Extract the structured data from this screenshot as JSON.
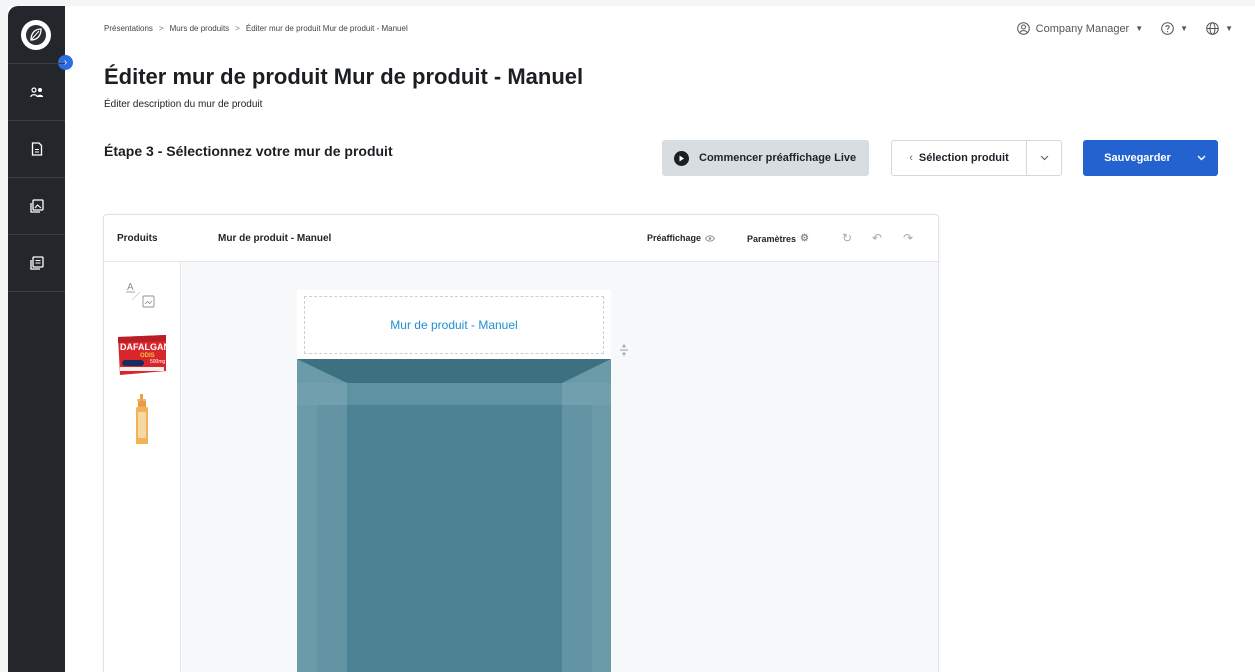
{
  "breadcrumb": {
    "items": [
      "Présentations",
      "Murs de produits",
      "Éditer mur de produit Mur de produit - Manuel"
    ],
    "separator": ">"
  },
  "topbar": {
    "user_label": "Company Manager"
  },
  "page": {
    "title": "Éditer mur de produit Mur de produit - Manuel",
    "subtitle": "Éditer description du mur de produit",
    "step_title": "Étape 3 - Sélectionnez votre mur de produit"
  },
  "actions": {
    "preview_label": "Commencer préaffichage Live",
    "select_label": "Sélection produit",
    "save_label": "Sauvegarder"
  },
  "editor": {
    "products_label": "Produits",
    "wall_label": "Mur de produit - Manuel",
    "preview_toggle": "Préaffichage",
    "settings_label": "Paramètres",
    "wall_header_text": "Mur de produit - Manuel",
    "text_image_letter": "A",
    "product_brand": "DAFALGAN",
    "product_line": "ODIS",
    "product_dose": "500mg"
  },
  "colors": {
    "sidebar": "#23272c",
    "primary": "#2362cf",
    "shelf": "#4b8394",
    "link": "#1d8fd0"
  }
}
